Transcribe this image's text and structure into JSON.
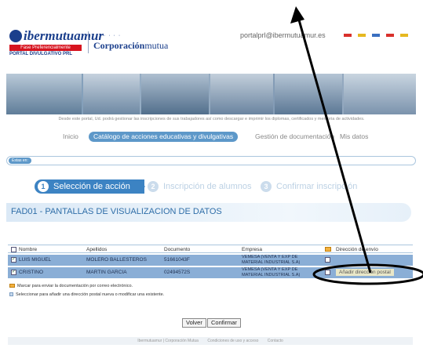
{
  "header": {
    "logo_text": "ibermutuamur",
    "logo_badge": "Fase Preferencialmente",
    "logo_sub": "PORTAL DIVULGATIVO PRL",
    "corporation_bold": "Corporación",
    "corporation_light": "mutua",
    "user_email": "portalprl@ibermutuamur.es",
    "flags": [
      "#d9302b",
      "#e6b820",
      "#3a6fc0",
      "#d9302b",
      "#e6b820"
    ]
  },
  "banner": {
    "caption": "Desde este portal, Ud. podrá gestionar las inscripciones de sus trabajadores así como descargar e imprimir los diplomas, certificados y memoria de actividades."
  },
  "nav": {
    "items": [
      "Inicio",
      "Catálogo de acciones educativas y divulgativas",
      "Gestión de documentación",
      "Mis datos"
    ],
    "active_index": 1
  },
  "breadcrumb": {
    "label": "Estas en:"
  },
  "steps": [
    {
      "num": "1",
      "label": "Selección de acción"
    },
    {
      "num": "2",
      "label": "Inscripción de alumnos"
    },
    {
      "num": "3",
      "label": "Confirmar inscripción"
    }
  ],
  "page_title": "FAD01 - PANTALLAS DE VISUALIZACION DE DATOS",
  "table": {
    "headers": [
      "Nombre",
      "Apellidos",
      "Documento",
      "Empresa",
      "Dirección de envío"
    ],
    "rows": [
      {
        "nombre": "LUIS MIGUEL",
        "apellidos": "MOLERO BALLESTEROS",
        "documento": "51661043F",
        "empresa": "VEMESA (VENTA Y EXP DE MATERIAL INDUSTRIAL S.A)",
        "checked": true,
        "direccion": ""
      },
      {
        "nombre": "CRISTINO",
        "apellidos": "MARTIN GARCIA",
        "documento": "02494572S",
        "empresa": "VEMESA (VENTA Y EXP DE MATERIAL INDUSTRIAL S.A)",
        "checked": true,
        "direccion": "Añadir dirección postal"
      }
    ]
  },
  "legend": {
    "envelope": "Marcar para enviar la documentación por correo electrónico.",
    "address": "Seleccionar para añadir una dirección postal nueva o modificar una existente."
  },
  "buttons": {
    "back": "Volver",
    "confirm": "Confirmar"
  },
  "footer": {
    "items": [
      "Ibermutuamur | Corporación Mutua",
      "Condiciones de uso y acceso",
      "Contacto"
    ]
  },
  "colors": {
    "primary_blue": "#3c83c3",
    "row_blue": "#8aaed6",
    "annotation": "#000000"
  }
}
